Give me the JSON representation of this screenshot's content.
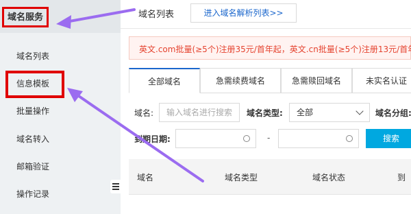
{
  "sidebar": {
    "title": "域名服务",
    "items": [
      {
        "label": "域名列表"
      },
      {
        "label": "信息模板"
      },
      {
        "label": "批量操作"
      },
      {
        "label": "域名转入"
      },
      {
        "label": "邮箱验证"
      },
      {
        "label": "操作记录"
      }
    ]
  },
  "header": {
    "title": "域名列表",
    "dns_link": "进入域名解析列表>>"
  },
  "notice": {
    "text": "英文.com批量(≥5个)注册35元/首年起，英文.cn批量(≥5个)注册13元/首年起"
  },
  "tabs": [
    {
      "label": "全部域名"
    },
    {
      "label": "急需续费域名"
    },
    {
      "label": "急需赎回域名"
    },
    {
      "label": "未实名认证"
    }
  ],
  "filters": {
    "domain_label": "域名:",
    "domain_placeholder": "输入域名进行搜索",
    "type_label": "域名类型:",
    "type_value": "全部",
    "group_label": "域名分组:",
    "expiry_label": "到期日期:",
    "range_sep": "-",
    "search_button": "搜索"
  },
  "table": {
    "columns": [
      "域名",
      "域名类型",
      "域名状态",
      "到"
    ]
  },
  "colors": {
    "accent": "#1a66cc",
    "highlight_box": "#e00000",
    "arrow": "#9b6cf0",
    "search_button": "#00a8e0",
    "notice_text": "#e5432f"
  }
}
